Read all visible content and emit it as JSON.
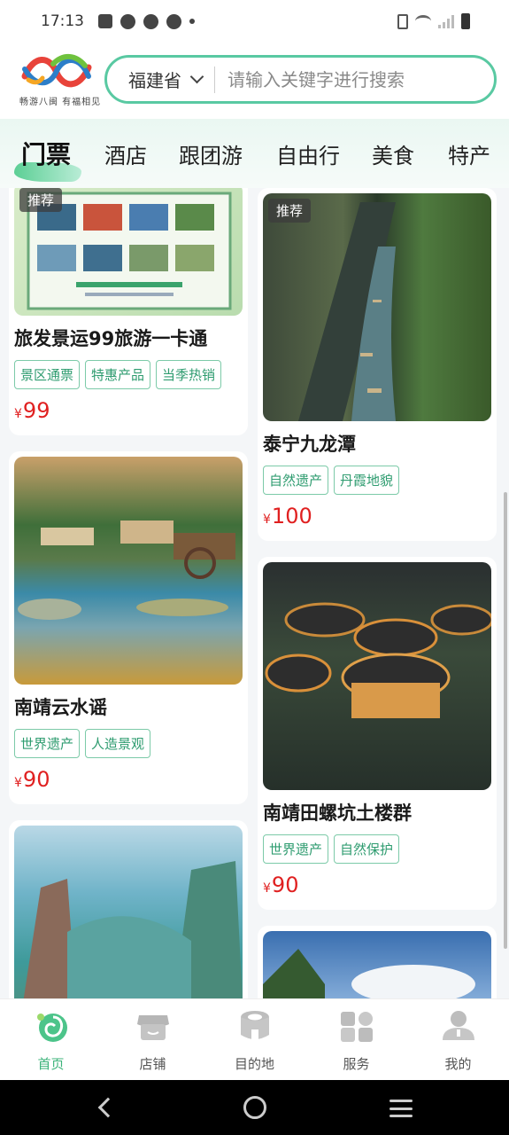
{
  "status_bar": {
    "time": "17:13"
  },
  "header": {
    "logo_text": "畅游八闽 有福相见",
    "province": "福建省",
    "search_placeholder": "请输入关键字进行搜索"
  },
  "tabs": [
    {
      "label": "门票",
      "active": true
    },
    {
      "label": "酒店"
    },
    {
      "label": "跟团游"
    },
    {
      "label": "自由行"
    },
    {
      "label": "美食"
    },
    {
      "label": "特产"
    }
  ],
  "cards_left": [
    {
      "badge": "推荐",
      "title": "旅发景运99旅游一卡通",
      "tags": [
        "景区通票",
        "特惠产品",
        "当季热销"
      ],
      "currency": "¥",
      "price": "99",
      "image": "tourism-card-poster"
    },
    {
      "badge": "",
      "title": "南靖云水谣",
      "tags": [
        "世界遗产",
        "人造景观"
      ],
      "currency": "¥",
      "price": "90",
      "image": "water-village"
    },
    {
      "badge": "",
      "title": "",
      "tags": [],
      "currency": "",
      "price": "",
      "image": "wuyi-mountain-painting"
    }
  ],
  "cards_right": [
    {
      "badge": "推荐",
      "title": "泰宁九龙潭",
      "tags": [
        "自然遗产",
        "丹霞地貌"
      ],
      "currency": "¥",
      "price": "100",
      "image": "canyon-boats"
    },
    {
      "badge": "",
      "title": "南靖田螺坑土楼群",
      "tags": [
        "世界遗产",
        "自然保护"
      ],
      "currency": "¥",
      "price": "90",
      "image": "tulou-night"
    },
    {
      "badge": "",
      "title": "",
      "tags": [],
      "currency": "",
      "price": "",
      "image": "mountain-sky"
    }
  ],
  "bottom_nav": [
    {
      "label": "首页",
      "icon": "home-icon",
      "active": true
    },
    {
      "label": "店铺",
      "icon": "shop-icon"
    },
    {
      "label": "目的地",
      "icon": "destination-icon"
    },
    {
      "label": "服务",
      "icon": "service-icon"
    },
    {
      "label": "我的",
      "icon": "profile-icon"
    }
  ],
  "colors": {
    "accent": "#59c9a2",
    "price": "#e02020",
    "tag": "#2f9c70"
  }
}
